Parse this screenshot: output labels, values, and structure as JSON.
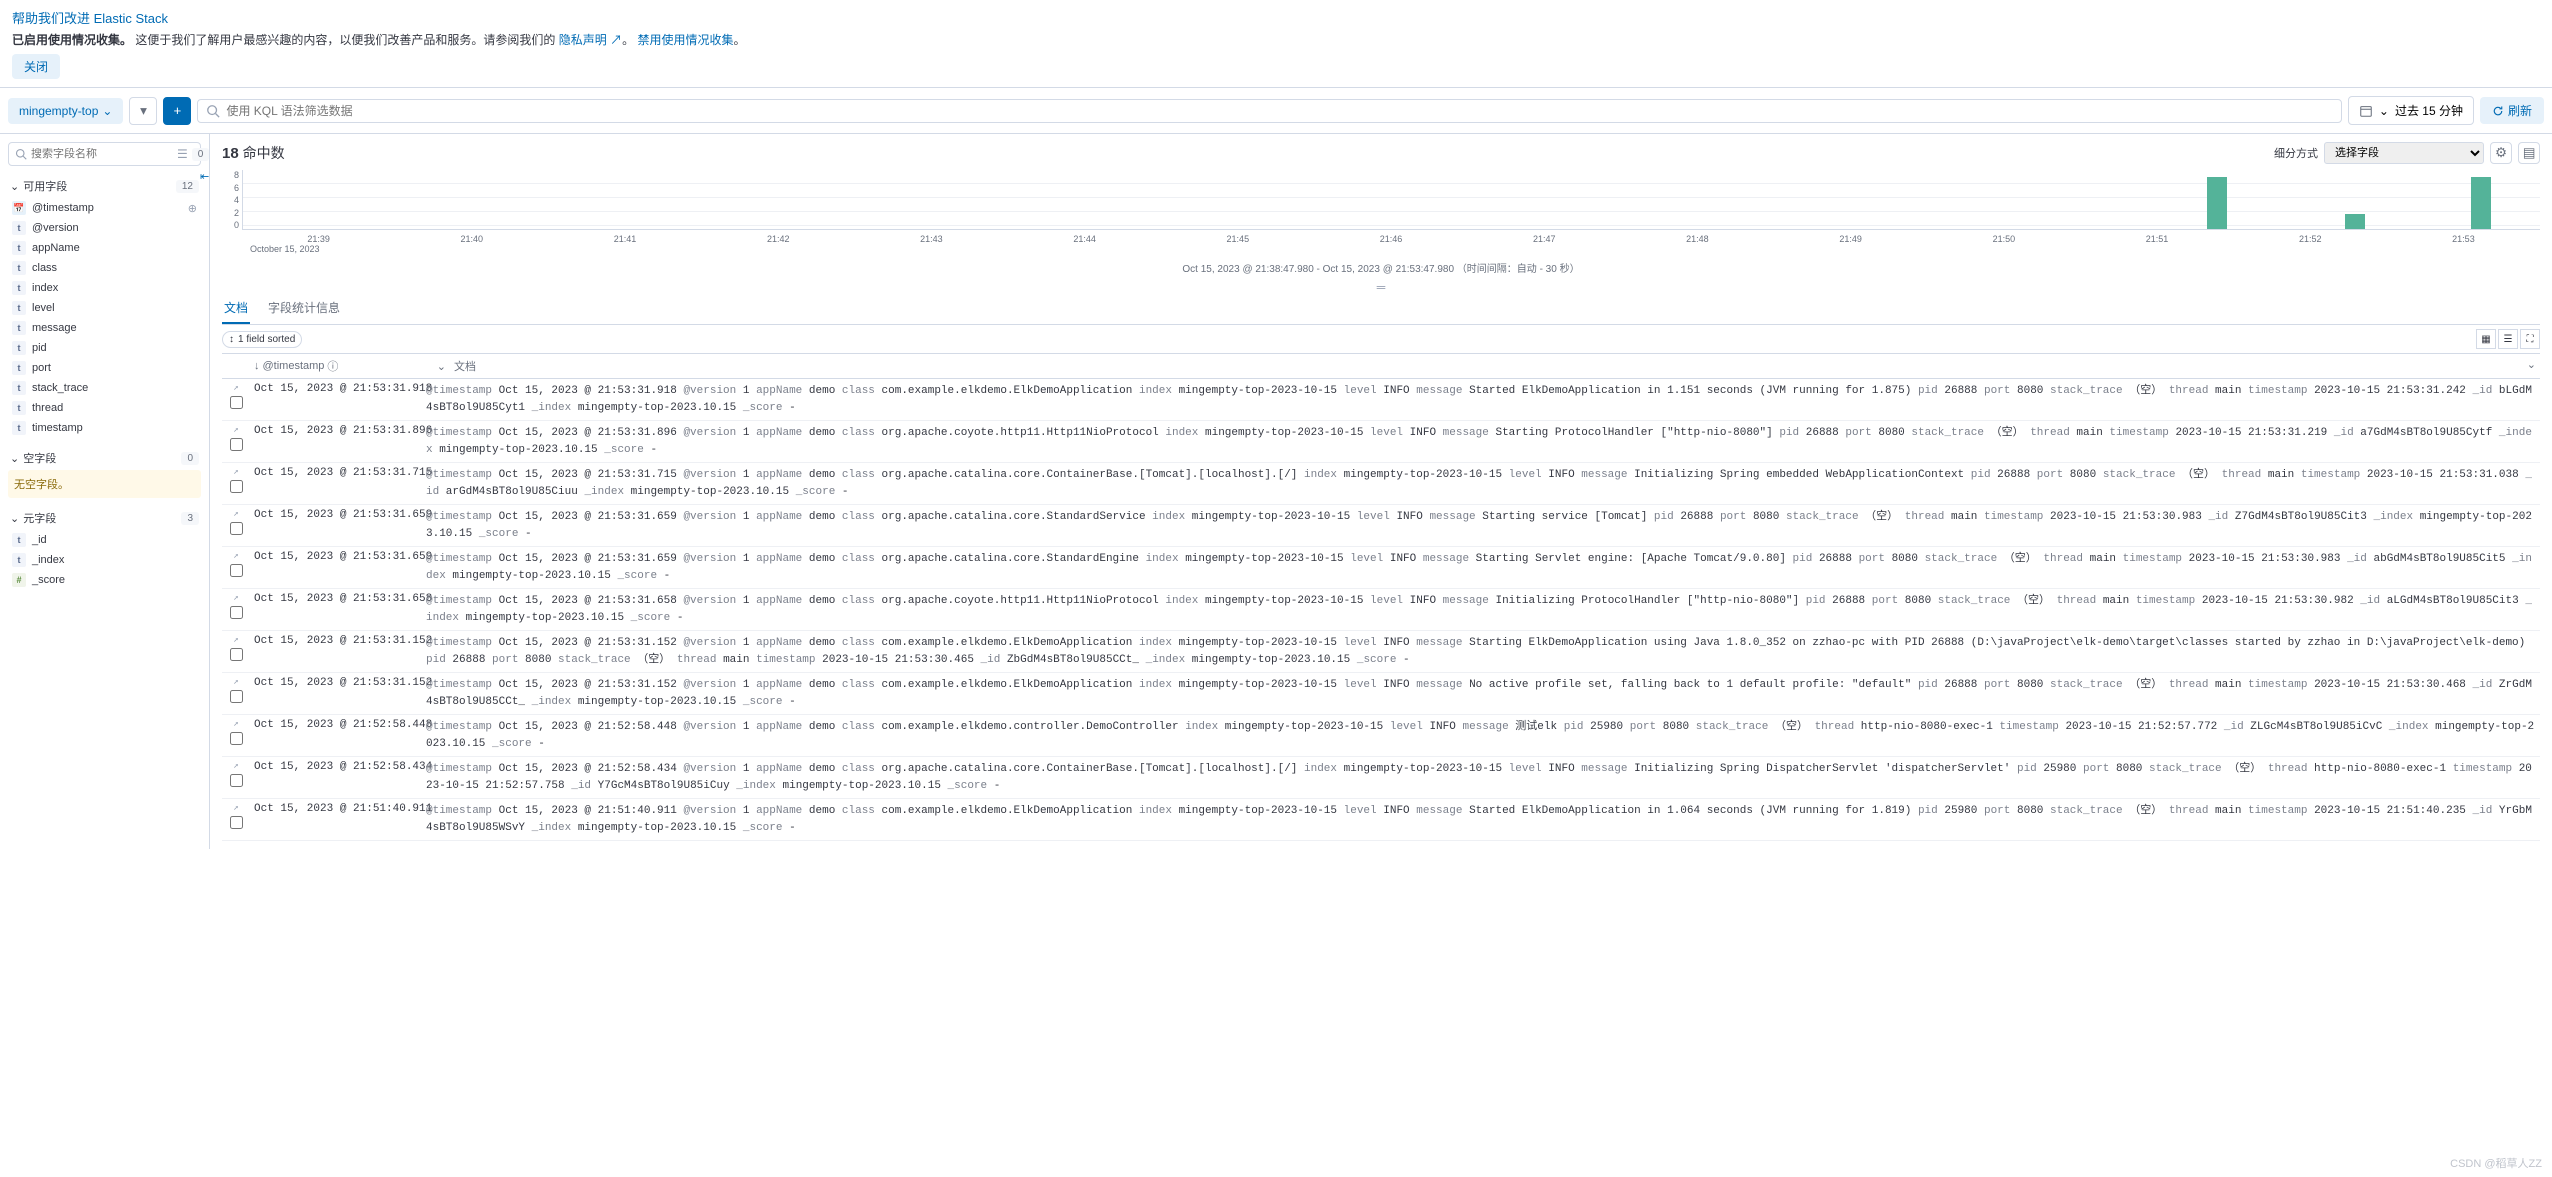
{
  "banner": {
    "title": "帮助我们改进 Elastic Stack",
    "text_prefix": "已启用使用情况收集。",
    "text_body": "这便于我们了解用户最感兴趣的内容，以便我们改善产品和服务。请参阅我们的",
    "privacy_link": "隐私声明",
    "period": "。",
    "disable_link": "禁用使用情况收集",
    "close": "关闭"
  },
  "toolbar": {
    "datasource": "mingempty-top",
    "search_placeholder": "使用 KQL 语法筛选数据",
    "time_range": "过去 15 分钟",
    "refresh": "刷新"
  },
  "sidebar": {
    "search_placeholder": "搜索字段名称",
    "filter_count": "0",
    "available": {
      "label": "可用字段",
      "count": "12"
    },
    "fields": [
      {
        "type": "date",
        "name": "@timestamp",
        "addable": true
      },
      {
        "type": "t",
        "name": "@version"
      },
      {
        "type": "t",
        "name": "appName"
      },
      {
        "type": "t",
        "name": "class"
      },
      {
        "type": "t",
        "name": "index"
      },
      {
        "type": "t",
        "name": "level"
      },
      {
        "type": "t",
        "name": "message"
      },
      {
        "type": "t",
        "name": "pid"
      },
      {
        "type": "t",
        "name": "port"
      },
      {
        "type": "t",
        "name": "stack_trace"
      },
      {
        "type": "t",
        "name": "thread"
      },
      {
        "type": "t",
        "name": "timestamp"
      }
    ],
    "empty": {
      "label": "空字段",
      "count": "0",
      "message": "无空字段。"
    },
    "meta": {
      "label": "元字段",
      "count": "3"
    },
    "meta_fields": [
      {
        "type": "t",
        "name": "_id"
      },
      {
        "type": "t",
        "name": "_index"
      },
      {
        "type": "num",
        "name": "_score"
      }
    ]
  },
  "content": {
    "hits_number": "18",
    "hits_label": "命中数",
    "breakdown_label": "细分方式",
    "breakdown_placeholder": "选择字段",
    "time_range_text": "Oct 15, 2023 @ 21:38:47.980 - Oct 15, 2023 @ 21:53:47.980 （时间间隔：自动 - 30 秒）",
    "tabs": {
      "docs": "文档",
      "stats": "字段统计信息"
    },
    "sort_label": "1 field sorted",
    "col_timestamp": "@timestamp",
    "col_doc": "文档",
    "x_start_label": "October 15, 2023"
  },
  "chart_data": {
    "type": "bar",
    "y_ticks": [
      "8",
      "6",
      "4",
      "2",
      "0"
    ],
    "x_ticks": [
      "21:39",
      "21:40",
      "21:41",
      "21:42",
      "21:43",
      "21:44",
      "21:45",
      "21:46",
      "21:47",
      "21:48",
      "21:49",
      "21:50",
      "21:51",
      "21:52",
      "21:53"
    ],
    "ylim": [
      0,
      8
    ],
    "bars": [
      {
        "x_pct": 85.5,
        "value": 7
      },
      {
        "x_pct": 91.5,
        "value": 2
      },
      {
        "x_pct": 97.0,
        "value": 7
      }
    ]
  },
  "rows": [
    {
      "ts": "Oct 15, 2023 @ 21:53:31.918",
      "fields": [
        [
          "@timestamp",
          "Oct 15, 2023 @ 21:53:31.918"
        ],
        [
          "@version",
          "1"
        ],
        [
          "appName",
          "demo"
        ],
        [
          "class",
          "com.example.elkdemo.ElkDemoApplication"
        ],
        [
          "index",
          "mingempty-top-2023-10-15"
        ],
        [
          "level",
          "INFO"
        ],
        [
          "message",
          "Started ElkDemoApplication in 1.151 seconds (JVM running for 1.875)"
        ],
        [
          "pid",
          "26888"
        ],
        [
          "port",
          "8080"
        ],
        [
          "stack_trace",
          "（空）"
        ],
        [
          "thread",
          "main"
        ],
        [
          "timestamp",
          "2023-10-15 21:53:31.242"
        ],
        [
          "_id",
          "bLGdM4sBT8ol9U85Cyt1"
        ],
        [
          "_index",
          "mingempty-top-2023.10.15"
        ],
        [
          "_score",
          "-"
        ]
      ]
    },
    {
      "ts": "Oct 15, 2023 @ 21:53:31.896",
      "fields": [
        [
          "@timestamp",
          "Oct 15, 2023 @ 21:53:31.896"
        ],
        [
          "@version",
          "1"
        ],
        [
          "appName",
          "demo"
        ],
        [
          "class",
          "org.apache.coyote.http11.Http11NioProtocol"
        ],
        [
          "index",
          "mingempty-top-2023-10-15"
        ],
        [
          "level",
          "INFO"
        ],
        [
          "message",
          "Starting ProtocolHandler [\"http-nio-8080\"]"
        ],
        [
          "pid",
          "26888"
        ],
        [
          "port",
          "8080"
        ],
        [
          "stack_trace",
          "（空）"
        ],
        [
          "thread",
          "main"
        ],
        [
          "timestamp",
          "2023-10-15 21:53:31.219"
        ],
        [
          "_id",
          "a7GdM4sBT8ol9U85Cytf"
        ],
        [
          "_index",
          "mingempty-top-2023.10.15"
        ],
        [
          "_score",
          "-"
        ]
      ]
    },
    {
      "ts": "Oct 15, 2023 @ 21:53:31.715",
      "fields": [
        [
          "@timestamp",
          "Oct 15, 2023 @ 21:53:31.715"
        ],
        [
          "@version",
          "1"
        ],
        [
          "appName",
          "demo"
        ],
        [
          "class",
          "org.apache.catalina.core.ContainerBase.[Tomcat].[localhost].[/]"
        ],
        [
          "index",
          "mingempty-top-2023-10-15"
        ],
        [
          "level",
          "INFO"
        ],
        [
          "message",
          "Initializing Spring embedded WebApplicationContext"
        ],
        [
          "pid",
          "26888"
        ],
        [
          "port",
          "8080"
        ],
        [
          "stack_trace",
          "（空）"
        ],
        [
          "thread",
          "main"
        ],
        [
          "timestamp",
          "2023-10-15 21:53:31.038"
        ],
        [
          "_id",
          "arGdM4sBT8ol9U85Ciuu"
        ],
        [
          "_index",
          "mingempty-top-2023.10.15"
        ],
        [
          "_score",
          "-"
        ]
      ]
    },
    {
      "ts": "Oct 15, 2023 @ 21:53:31.659",
      "fields": [
        [
          "@timestamp",
          "Oct 15, 2023 @ 21:53:31.659"
        ],
        [
          "@version",
          "1"
        ],
        [
          "appName",
          "demo"
        ],
        [
          "class",
          "org.apache.catalina.core.StandardService"
        ],
        [
          "index",
          "mingempty-top-2023-10-15"
        ],
        [
          "level",
          "INFO"
        ],
        [
          "message",
          "Starting service [Tomcat]"
        ],
        [
          "pid",
          "26888"
        ],
        [
          "port",
          "8080"
        ],
        [
          "stack_trace",
          "（空）"
        ],
        [
          "thread",
          "main"
        ],
        [
          "timestamp",
          "2023-10-15 21:53:30.983"
        ],
        [
          "_id",
          "Z7GdM4sBT8ol9U85Cit3"
        ],
        [
          "_index",
          "mingempty-top-2023.10.15"
        ],
        [
          "_score",
          "-"
        ]
      ]
    },
    {
      "ts": "Oct 15, 2023 @ 21:53:31.659",
      "fields": [
        [
          "@timestamp",
          "Oct 15, 2023 @ 21:53:31.659"
        ],
        [
          "@version",
          "1"
        ],
        [
          "appName",
          "demo"
        ],
        [
          "class",
          "org.apache.catalina.core.StandardEngine"
        ],
        [
          "index",
          "mingempty-top-2023-10-15"
        ],
        [
          "level",
          "INFO"
        ],
        [
          "message",
          "Starting Servlet engine: [Apache Tomcat/9.0.80]"
        ],
        [
          "pid",
          "26888"
        ],
        [
          "port",
          "8080"
        ],
        [
          "stack_trace",
          "（空）"
        ],
        [
          "thread",
          "main"
        ],
        [
          "timestamp",
          "2023-10-15 21:53:30.983"
        ],
        [
          "_id",
          "abGdM4sBT8ol9U85Cit5"
        ],
        [
          "_index",
          "mingempty-top-2023.10.15"
        ],
        [
          "_score",
          "-"
        ]
      ]
    },
    {
      "ts": "Oct 15, 2023 @ 21:53:31.658",
      "fields": [
        [
          "@timestamp",
          "Oct 15, 2023 @ 21:53:31.658"
        ],
        [
          "@version",
          "1"
        ],
        [
          "appName",
          "demo"
        ],
        [
          "class",
          "org.apache.coyote.http11.Http11NioProtocol"
        ],
        [
          "index",
          "mingempty-top-2023-10-15"
        ],
        [
          "level",
          "INFO"
        ],
        [
          "message",
          "Initializing ProtocolHandler [\"http-nio-8080\"]"
        ],
        [
          "pid",
          "26888"
        ],
        [
          "port",
          "8080"
        ],
        [
          "stack_trace",
          "（空）"
        ],
        [
          "thread",
          "main"
        ],
        [
          "timestamp",
          "2023-10-15 21:53:30.982"
        ],
        [
          "_id",
          "aLGdM4sBT8ol9U85Cit3"
        ],
        [
          "_index",
          "mingempty-top-2023.10.15"
        ],
        [
          "_score",
          "-"
        ]
      ]
    },
    {
      "ts": "Oct 15, 2023 @ 21:53:31.152",
      "fields": [
        [
          "@timestamp",
          "Oct 15, 2023 @ 21:53:31.152"
        ],
        [
          "@version",
          "1"
        ],
        [
          "appName",
          "demo"
        ],
        [
          "class",
          "com.example.elkdemo.ElkDemoApplication"
        ],
        [
          "index",
          "mingempty-top-2023-10-15"
        ],
        [
          "level",
          "INFO"
        ],
        [
          "message",
          "Starting ElkDemoApplication using Java 1.8.0_352 on zzhao-pc with PID 26888 (D:\\javaProject\\elk-demo\\target\\classes started by zzhao in D:\\javaProject\\elk-demo)"
        ],
        [
          "pid",
          "26888"
        ],
        [
          "port",
          "8080"
        ],
        [
          "stack_trace",
          "（空）"
        ],
        [
          "thread",
          "main"
        ],
        [
          "timestamp",
          "2023-10-15 21:53:30.465"
        ],
        [
          "_id",
          "ZbGdM4sBT8ol9U85CCt_"
        ],
        [
          "_index",
          "mingempty-top-2023.10.15"
        ],
        [
          "_score",
          "-"
        ]
      ]
    },
    {
      "ts": "Oct 15, 2023 @ 21:53:31.152",
      "fields": [
        [
          "@timestamp",
          "Oct 15, 2023 @ 21:53:31.152"
        ],
        [
          "@version",
          "1"
        ],
        [
          "appName",
          "demo"
        ],
        [
          "class",
          "com.example.elkdemo.ElkDemoApplication"
        ],
        [
          "index",
          "mingempty-top-2023-10-15"
        ],
        [
          "level",
          "INFO"
        ],
        [
          "message",
          "No active profile set, falling back to 1 default profile: \"default\""
        ],
        [
          "pid",
          "26888"
        ],
        [
          "port",
          "8080"
        ],
        [
          "stack_trace",
          "（空）"
        ],
        [
          "thread",
          "main"
        ],
        [
          "timestamp",
          "2023-10-15 21:53:30.468"
        ],
        [
          "_id",
          "ZrGdM4sBT8ol9U85CCt_"
        ],
        [
          "_index",
          "mingempty-top-2023.10.15"
        ],
        [
          "_score",
          "-"
        ]
      ]
    },
    {
      "ts": "Oct 15, 2023 @ 21:52:58.448",
      "fields": [
        [
          "@timestamp",
          "Oct 15, 2023 @ 21:52:58.448"
        ],
        [
          "@version",
          "1"
        ],
        [
          "appName",
          "demo"
        ],
        [
          "class",
          "com.example.elkdemo.controller.DemoController"
        ],
        [
          "index",
          "mingempty-top-2023-10-15"
        ],
        [
          "level",
          "INFO"
        ],
        [
          "message",
          "测试elk"
        ],
        [
          "pid",
          "25980"
        ],
        [
          "port",
          "8080"
        ],
        [
          "stack_trace",
          "（空）"
        ],
        [
          "thread",
          "http-nio-8080-exec-1"
        ],
        [
          "timestamp",
          "2023-10-15 21:52:57.772"
        ],
        [
          "_id",
          "ZLGcM4sBT8ol9U85iCvC"
        ],
        [
          "_index",
          "mingempty-top-2023.10.15"
        ],
        [
          "_score",
          "-"
        ]
      ]
    },
    {
      "ts": "Oct 15, 2023 @ 21:52:58.434",
      "fields": [
        [
          "@timestamp",
          "Oct 15, 2023 @ 21:52:58.434"
        ],
        [
          "@version",
          "1"
        ],
        [
          "appName",
          "demo"
        ],
        [
          "class",
          "org.apache.catalina.core.ContainerBase.[Tomcat].[localhost].[/]"
        ],
        [
          "index",
          "mingempty-top-2023-10-15"
        ],
        [
          "level",
          "INFO"
        ],
        [
          "message",
          "Initializing Spring DispatcherServlet 'dispatcherServlet'"
        ],
        [
          "pid",
          "25980"
        ],
        [
          "port",
          "8080"
        ],
        [
          "stack_trace",
          "（空）"
        ],
        [
          "thread",
          "http-nio-8080-exec-1"
        ],
        [
          "timestamp",
          "2023-10-15 21:52:57.758"
        ],
        [
          "_id",
          "Y7GcM4sBT8ol9U85iCuy"
        ],
        [
          "_index",
          "mingempty-top-2023.10.15"
        ],
        [
          "_score",
          "-"
        ]
      ]
    },
    {
      "ts": "Oct 15, 2023 @ 21:51:40.911",
      "fields": [
        [
          "@timestamp",
          "Oct 15, 2023 @ 21:51:40.911"
        ],
        [
          "@version",
          "1"
        ],
        [
          "appName",
          "demo"
        ],
        [
          "class",
          "com.example.elkdemo.ElkDemoApplication"
        ],
        [
          "index",
          "mingempty-top-2023-10-15"
        ],
        [
          "level",
          "INFO"
        ],
        [
          "message",
          "Started ElkDemoApplication in 1.064 seconds (JVM running for 1.819)"
        ],
        [
          "pid",
          "25980"
        ],
        [
          "port",
          "8080"
        ],
        [
          "stack_trace",
          "（空）"
        ],
        [
          "thread",
          "main"
        ],
        [
          "timestamp",
          "2023-10-15 21:51:40.235"
        ],
        [
          "_id",
          "YrGbM4sBT8ol9U85WSvY"
        ],
        [
          "_index",
          "mingempty-top-2023.10.15"
        ],
        [
          "_score",
          "-"
        ]
      ]
    }
  ],
  "watermark": "CSDN @稻草人ZZ"
}
